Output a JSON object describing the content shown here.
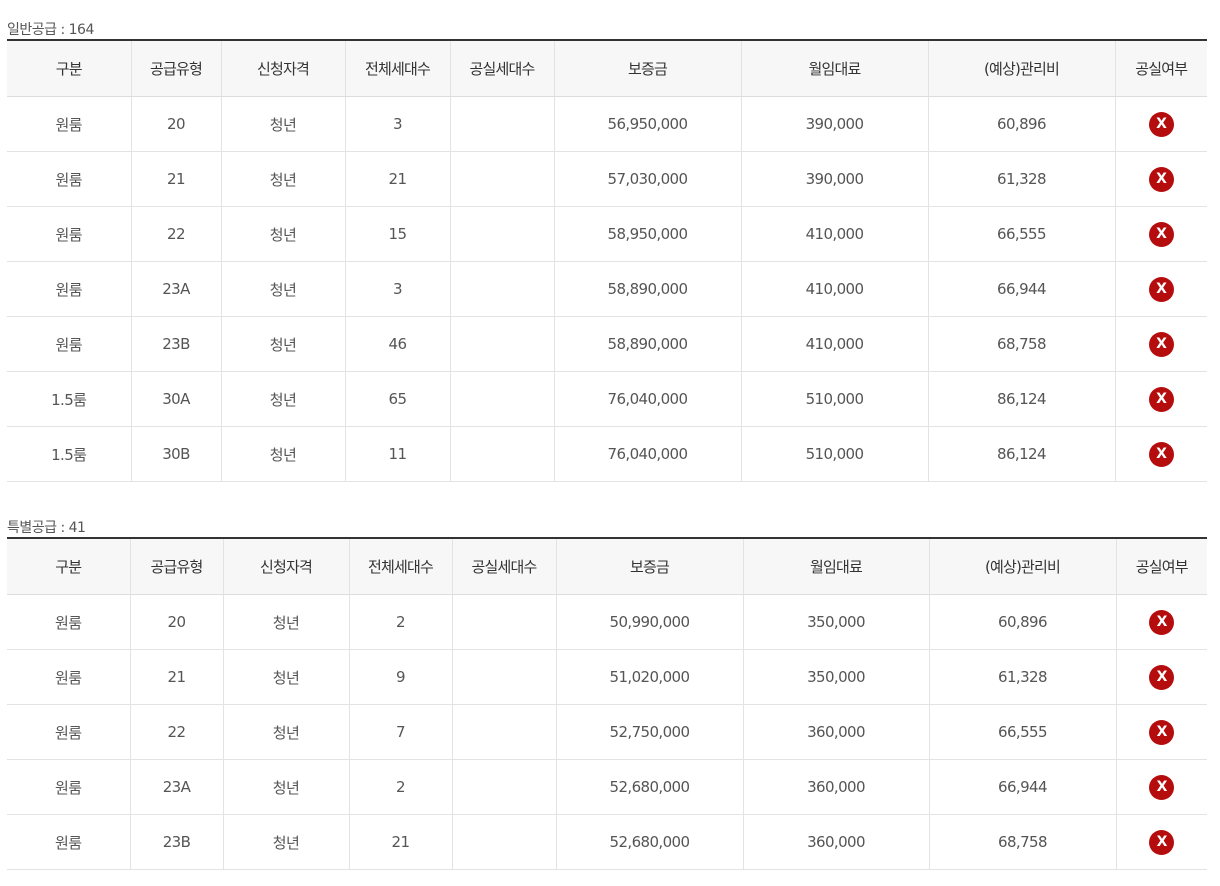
{
  "colors": {
    "vacancy_no": "#b50d0d",
    "header_bg": "#f7f7f7",
    "top_border": "#333333"
  },
  "columns": [
    "구분",
    "공급유형",
    "신청자격",
    "전체세대수",
    "공실세대수",
    "보증금",
    "월임대료",
    "(예상)관리비",
    "공실여부"
  ],
  "general": {
    "caption": "일반공급 : 164",
    "rows": [
      {
        "type": "원룸",
        "supply": "20",
        "qual": "청년",
        "total": "3",
        "vacant": "",
        "deposit": "56,950,000",
        "rent": "390,000",
        "fee": "60,896",
        "vacancy_mark": "X",
        "vacancy_icon": "x-circle-icon"
      },
      {
        "type": "원룸",
        "supply": "21",
        "qual": "청년",
        "total": "21",
        "vacant": "",
        "deposit": "57,030,000",
        "rent": "390,000",
        "fee": "61,328",
        "vacancy_mark": "X",
        "vacancy_icon": "x-circle-icon"
      },
      {
        "type": "원룸",
        "supply": "22",
        "qual": "청년",
        "total": "15",
        "vacant": "",
        "deposit": "58,950,000",
        "rent": "410,000",
        "fee": "66,555",
        "vacancy_mark": "X",
        "vacancy_icon": "x-circle-icon"
      },
      {
        "type": "원룸",
        "supply": "23A",
        "qual": "청년",
        "total": "3",
        "vacant": "",
        "deposit": "58,890,000",
        "rent": "410,000",
        "fee": "66,944",
        "vacancy_mark": "X",
        "vacancy_icon": "x-circle-icon"
      },
      {
        "type": "원룸",
        "supply": "23B",
        "qual": "청년",
        "total": "46",
        "vacant": "",
        "deposit": "58,890,000",
        "rent": "410,000",
        "fee": "68,758",
        "vacancy_mark": "X",
        "vacancy_icon": "x-circle-icon"
      },
      {
        "type": "1.5룸",
        "supply": "30A",
        "qual": "청년",
        "total": "65",
        "vacant": "",
        "deposit": "76,040,000",
        "rent": "510,000",
        "fee": "86,124",
        "vacancy_mark": "X",
        "vacancy_icon": "x-circle-icon"
      },
      {
        "type": "1.5룸",
        "supply": "30B",
        "qual": "청년",
        "total": "11",
        "vacant": "",
        "deposit": "76,040,000",
        "rent": "510,000",
        "fee": "86,124",
        "vacancy_mark": "X",
        "vacancy_icon": "x-circle-icon"
      }
    ]
  },
  "special": {
    "caption": "특별공급 : 41",
    "rows": [
      {
        "type": "원룸",
        "supply": "20",
        "qual": "청년",
        "total": "2",
        "vacant": "",
        "deposit": "50,990,000",
        "rent": "350,000",
        "fee": "60,896",
        "vacancy_mark": "X",
        "vacancy_icon": "x-circle-icon"
      },
      {
        "type": "원룸",
        "supply": "21",
        "qual": "청년",
        "total": "9",
        "vacant": "",
        "deposit": "51,020,000",
        "rent": "350,000",
        "fee": "61,328",
        "vacancy_mark": "X",
        "vacancy_icon": "x-circle-icon"
      },
      {
        "type": "원룸",
        "supply": "22",
        "qual": "청년",
        "total": "7",
        "vacant": "",
        "deposit": "52,750,000",
        "rent": "360,000",
        "fee": "66,555",
        "vacancy_mark": "X",
        "vacancy_icon": "x-circle-icon"
      },
      {
        "type": "원룸",
        "supply": "23A",
        "qual": "청년",
        "total": "2",
        "vacant": "",
        "deposit": "52,680,000",
        "rent": "360,000",
        "fee": "66,944",
        "vacancy_mark": "X",
        "vacancy_icon": "x-circle-icon"
      },
      {
        "type": "원룸",
        "supply": "23B",
        "qual": "청년",
        "total": "21",
        "vacant": "",
        "deposit": "52,680,000",
        "rent": "360,000",
        "fee": "68,758",
        "vacancy_mark": "X",
        "vacancy_icon": "x-circle-icon"
      }
    ]
  }
}
